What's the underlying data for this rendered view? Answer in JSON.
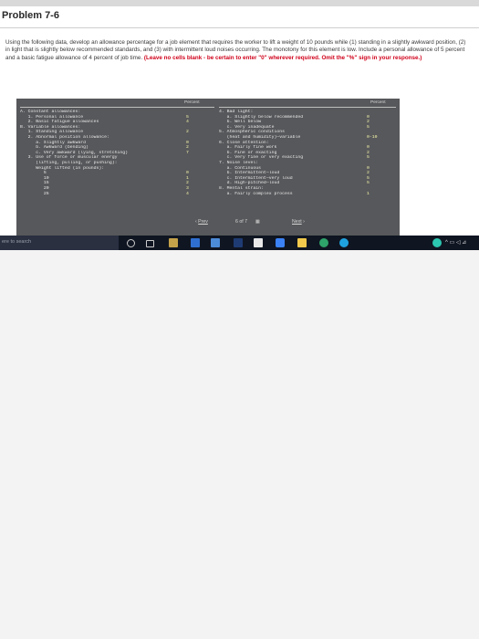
{
  "header": {
    "title": "Problem 7-6"
  },
  "prompt": {
    "text": "Using the following data, develop an allowance percentage for a job element that requires the worker to lift a weight of 10 pounds while (1) standing in a slightly awkward position, (2) in light that is slightly below recommended standards, and (3) with intermittent loud noises occurring. The monotony for this element is low. Include a personal allowance of 5 percent and a basic fatigue allowance of 4 percent of job time.",
    "warning": "(Leave no cells blank - be certain to enter \"0\" wherever required. Omit the \"%\" sign in your response.)"
  },
  "table": {
    "left_percent_header": "Percent",
    "right_percent_header": "Percent",
    "left_labels": [
      "A. Constant allowances:",
      "   1. Personal allowance",
      "   2. Basic fatigue allowances",
      "B. Variable allowances:",
      "   1. Standing allowance",
      "   2. Abnormal position allowance:",
      "      a. Slightly awkward",
      "      b. Awkward (bending)",
      "      c. Very awkward (lying, stretching)",
      "   3. Use of force or muscular energy",
      "      (lifting, pulling, or pushing):",
      "      Weight lifted (in pounds):",
      "         5",
      "         10",
      "         15",
      "         20",
      "         25"
    ],
    "left_values": [
      "",
      "5",
      "4",
      "",
      "2",
      "",
      "0",
      "2",
      "7",
      "",
      "",
      "",
      "0",
      "1",
      "2",
      "3",
      "4"
    ],
    "right_labels": [
      "4. Bad light:",
      "   a. Slightly below recommended",
      "   b. Well below",
      "   c. Very inadequate",
      "5. Atmospheric conditions",
      "   (heat and humidity)—variable",
      "6. Close attention:",
      "   a. Fairly fine work",
      "   b. Fine or exacting",
      "   c. Very fine or very exacting",
      "7. Noise level:",
      "   a. Continuous",
      "   b. Intermittent—loud",
      "   c. Intermittent—very loud",
      "   d. High-pitched—loud",
      "8. Mental strain:",
      "   a. Fairly complex process"
    ],
    "right_values": [
      "",
      "0",
      "2",
      "5",
      "",
      "0-10",
      "",
      "0",
      "2",
      "5",
      "",
      "0",
      "2",
      "5",
      "5",
      "",
      "1"
    ]
  },
  "pager": {
    "prev_label": "Prev",
    "page_label": "6 of 7",
    "next_label": "Next"
  },
  "taskbar": {
    "search_placeholder": "ere to search"
  },
  "colors": {
    "warning": "#d0021b",
    "dark_panel": "#57585b",
    "taskbar": "#0f1521"
  }
}
